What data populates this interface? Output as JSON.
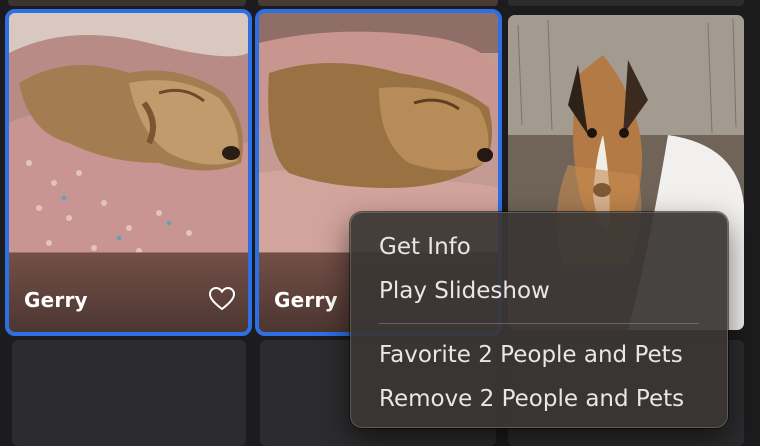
{
  "grid": {
    "tiles": [
      {
        "name": "Gerry",
        "favorited": false,
        "selected": true
      },
      {
        "name": "Gerry",
        "selected": true
      },
      {
        "name": "",
        "selected": false
      }
    ]
  },
  "context_menu": {
    "items": [
      {
        "label": "Get Info"
      },
      {
        "label": "Play Slideshow"
      },
      {
        "label": "Favorite 2 People and Pets"
      },
      {
        "label": "Remove 2 People and Pets"
      }
    ]
  },
  "colors": {
    "selection_border": "#2f6fe6",
    "menu_background": "#3a3634",
    "menu_text": "#e9e6e4",
    "background": "#1c1c1e"
  },
  "icons": {
    "favorite": "heart-outline-icon"
  }
}
